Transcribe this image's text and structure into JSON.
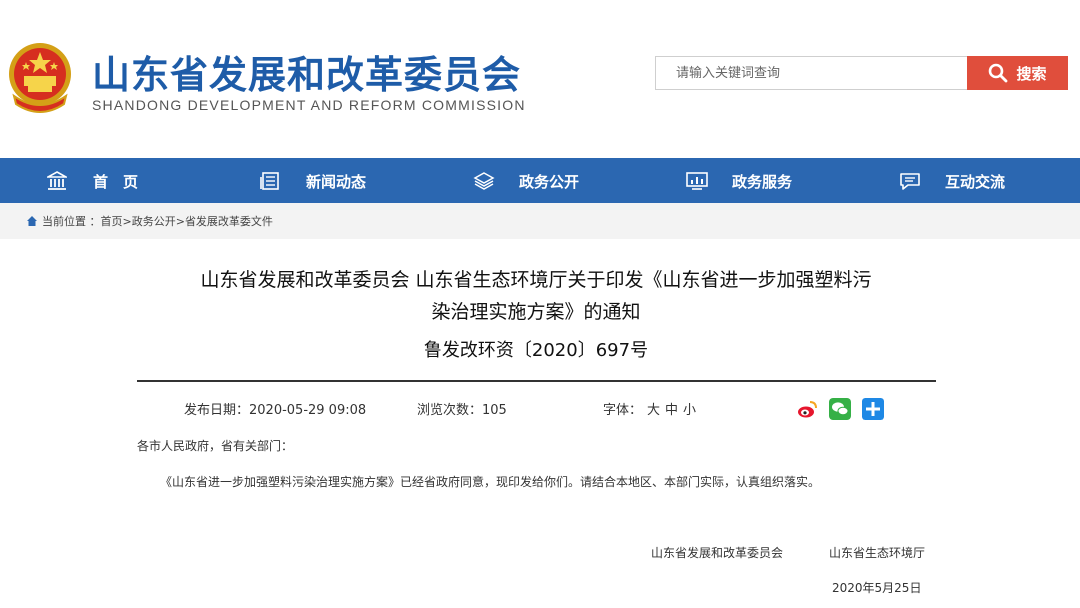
{
  "header": {
    "title": "山东省发展和改革委员会",
    "subtitle": "SHANDONG DEVELOPMENT AND REFORM COMMISSION",
    "brand_color": "#1e5ca8"
  },
  "search": {
    "placeholder": "请输入关键词查询",
    "button_label": "搜索",
    "button_color": "#e04e3c"
  },
  "nav": {
    "color": "#2b67b1",
    "items": [
      {
        "label": "首　页",
        "icon": "bank-icon"
      },
      {
        "label": "新闻动态",
        "icon": "newspaper-icon"
      },
      {
        "label": "政务公开",
        "icon": "layers-icon"
      },
      {
        "label": "政务服务",
        "icon": "chart-monitor-icon"
      },
      {
        "label": "互动交流",
        "icon": "chat-icon"
      }
    ]
  },
  "breadcrumb": {
    "prefix": "当前位置 ：",
    "items": [
      "首页>",
      "政务公开>",
      "省发展改革委文件"
    ]
  },
  "article": {
    "title": "山东省发展和改革委员会 山东省生态环境厅关于印发《山东省进一步加强塑料污染治理实施方案》的通知",
    "doc_number": "鲁发改环资〔2020〕697号",
    "publish_date": "发布日期：2020-05-29  09:08",
    "views": "浏览次数：105",
    "font_label": "字体：",
    "font_sizes": [
      "大",
      "中",
      "小"
    ],
    "share": [
      "weibo-icon",
      "wechat-icon",
      "plus-share-icon"
    ],
    "greeting": "各市人民政府，省有关部门：",
    "body": "《山东省进一步加强塑料污染治理实施方案》已经省政府同意，现印发给你们。请结合本地区、本部门实际，认真组织落实。",
    "signers": [
      "山东省发展和改革委员会",
      "山东省生态环境厅"
    ],
    "sign_date": "2020年5月25日"
  }
}
